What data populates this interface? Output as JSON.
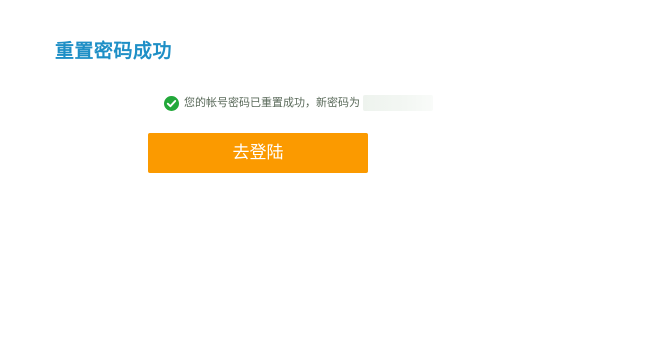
{
  "page": {
    "title": "重置密码成功"
  },
  "message": {
    "icon": "check-circle-icon",
    "text": "您的帐号密码已重置成功，新密码为",
    "new_password": ""
  },
  "actions": {
    "login_label": "去登陆"
  },
  "colors": {
    "title": "#1e8fc6",
    "success_icon": "#22a83a",
    "button_bg": "#fb9a00",
    "button_text": "#ffffff"
  }
}
